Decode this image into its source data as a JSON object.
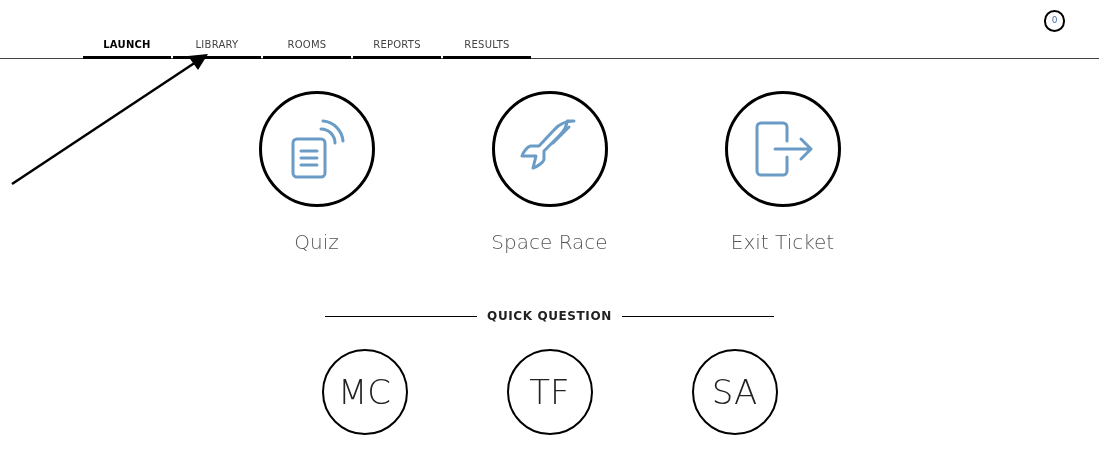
{
  "tabs": [
    {
      "label": "LAUNCH",
      "selected": true
    },
    {
      "label": "LIBRARY",
      "selected": false
    },
    {
      "label": "ROOMS",
      "selected": false
    },
    {
      "label": "REPORTS",
      "selected": false
    },
    {
      "label": "RESULTS",
      "selected": false
    }
  ],
  "notification_count": "0",
  "activities": [
    {
      "kind": "quiz",
      "label": "Quiz"
    },
    {
      "kind": "rocket",
      "label": "Space Race"
    },
    {
      "kind": "exit",
      "label": "Exit Ticket"
    }
  ],
  "quick_question": {
    "title": "QUICK QUESTION",
    "options": [
      "MC",
      "TF",
      "SA"
    ]
  }
}
